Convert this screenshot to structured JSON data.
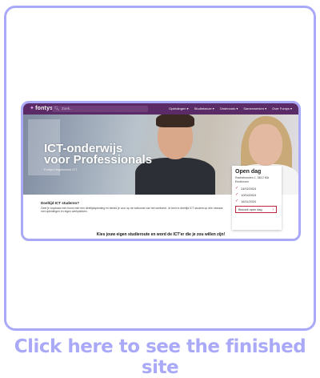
{
  "site": {
    "logo": "fontys",
    "search_placeholder": "Zoek...",
    "menu": [
      "Opleidingen ▾",
      "Studiekeuze ▾",
      "Onderzoek ▾",
      "Samenwerken ▾",
      "Over Fontys ▾"
    ],
    "hero_title_line1": "ICT-onderwijs",
    "hero_title_line2": "voor Professionals",
    "hero_sub": "Fontys Hogeschool ICT",
    "open_dag": {
      "title": "Open dag",
      "address": "Rachelsmolen 1, 5612 MA Eindhoven",
      "dates": [
        "24/02/2024",
        "10/04/2024",
        "16/11/2024"
      ],
      "button": "Bezoek open dag"
    },
    "content_title": "Doeltijd ICT studeren?",
    "content_body": "Geef je loopbaan een boost met een deeltijdopleiding en bereid je voor op de toekomst van het werkveld. Je bent in deeltijd ICT-student op drie niveaus met opleidingen en eigen werkplekken.",
    "bottom_heading": "Kies jouw eigen studieroute en word de ICT'er die je zou willen zijn!"
  },
  "cta": "Click here to see the finished site",
  "colors": {
    "frame": "#a9a9f7",
    "nav": "#5a2b66",
    "accent": "#c0293f"
  }
}
